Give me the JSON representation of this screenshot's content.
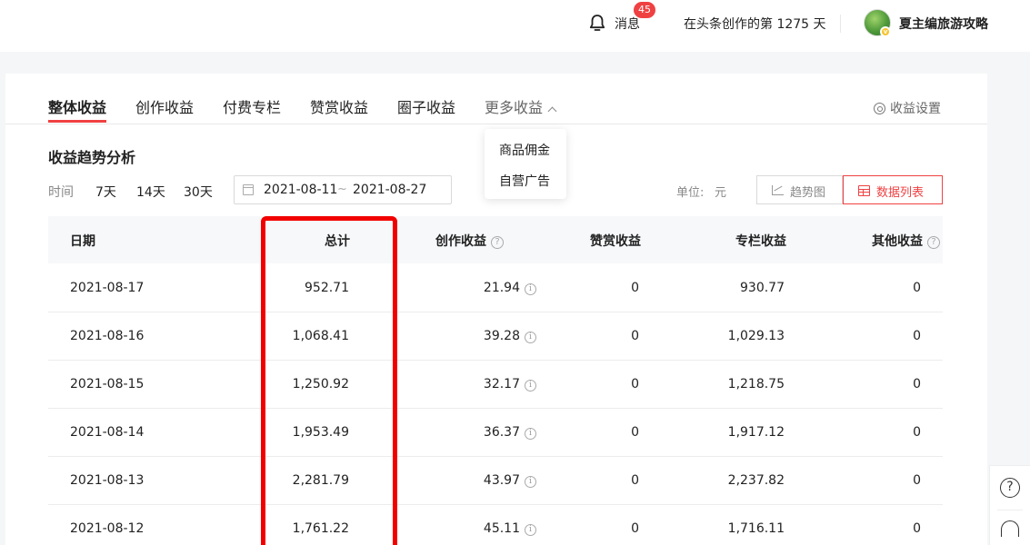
{
  "topbar": {
    "bell_icon": "bell-icon",
    "messages_label": "消息",
    "messages_badge": "45",
    "streak_text": "在头条创作的第 1275 天",
    "avatar_icon": "avatar",
    "username": "夏主编旅游攻略"
  },
  "tabs": [
    {
      "label": "整体收益",
      "active": true
    },
    {
      "label": "创作收益"
    },
    {
      "label": "付费专栏"
    },
    {
      "label": "赞赏收益"
    },
    {
      "label": "圈子收益"
    },
    {
      "label": "更多收益"
    }
  ],
  "settings_label": "收益设置",
  "dropdown": [
    "商品佣金",
    "自营广告"
  ],
  "section_title": "收益趋势分析",
  "filters": {
    "time_label": "时间",
    "ranges": [
      "7天",
      "14天",
      "30天"
    ],
    "date_start": "2021-08-11",
    "date_sep": "~",
    "date_end": "2021-08-27",
    "unit_label": "单位:",
    "unit_value": "元",
    "trend_view": "趋势图",
    "list_view": "数据列表"
  },
  "table": {
    "headers": [
      "日期",
      "总计",
      "创作收益",
      "赞赏收益",
      "专栏收益",
      "其他收益"
    ],
    "rows": [
      [
        "2021-08-17",
        "952.71",
        "21.94",
        "0",
        "930.77",
        "0"
      ],
      [
        "2021-08-16",
        "1,068.41",
        "39.28",
        "0",
        "1,029.13",
        "0"
      ],
      [
        "2021-08-15",
        "1,250.92",
        "32.17",
        "0",
        "1,218.75",
        "0"
      ],
      [
        "2021-08-14",
        "1,953.49",
        "36.37",
        "0",
        "1,917.12",
        "0"
      ],
      [
        "2021-08-13",
        "2,281.79",
        "43.97",
        "0",
        "2,237.82",
        "0"
      ],
      [
        "2021-08-12",
        "1,761.22",
        "45.11",
        "0",
        "1,716.11",
        "0"
      ]
    ]
  },
  "help_glyph": "?",
  "info_glyph": "i",
  "colors": {
    "accent": "#f04142",
    "highlight": "#f20000"
  }
}
